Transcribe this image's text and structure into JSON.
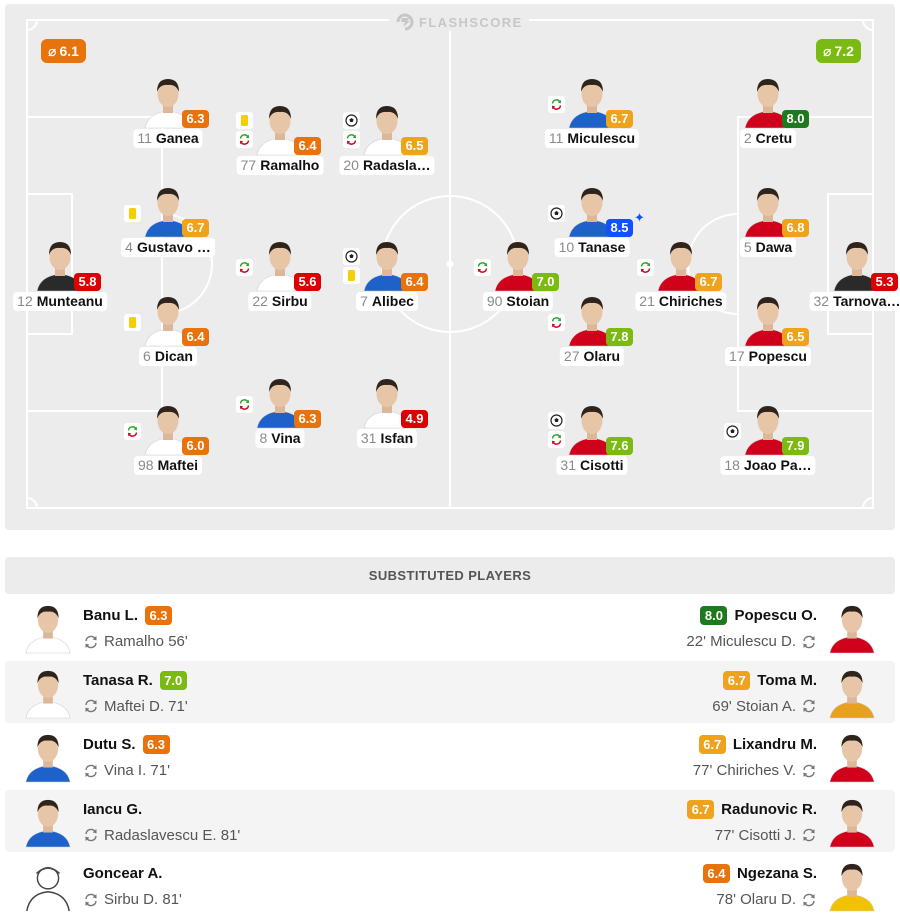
{
  "brand": "FLASHSCORE",
  "colors": {
    "rating_red": "#dc0000",
    "rating_orange": "#e8720c",
    "rating_yellow": "#efa21b",
    "rating_green": "#7aba12",
    "rating_darkgreen": "#1f7a1f",
    "rating_blue": "#1450ff"
  },
  "home": {
    "average": "6.1",
    "avg_color": "#e8720c",
    "players": [
      {
        "number": "11",
        "name": "Ganea",
        "rating": "6.3",
        "color": "#e8720c",
        "icons": [],
        "star": false,
        "shirt": "#ffffff"
      },
      {
        "number": "77",
        "name": "Ramalho",
        "rating": "6.4",
        "color": "#e8720c",
        "icons": [
          "yellow-card",
          "substitution"
        ],
        "star": false,
        "shirt": "#ffffff"
      },
      {
        "number": "20",
        "name": "Radasla…",
        "rating": "6.5",
        "color": "#efa21b",
        "icons": [
          "goal",
          "substitution"
        ],
        "star": false,
        "shirt": "#ffffff"
      },
      {
        "number": "4",
        "name": "Gustavo …",
        "rating": "6.7",
        "color": "#efa21b",
        "icons": [
          "yellow-card"
        ],
        "star": false,
        "shirt": "#1e62c9"
      },
      {
        "number": "12",
        "name": "Munteanu",
        "rating": "5.8",
        "color": "#dc0000",
        "icons": [],
        "star": false,
        "shirt": "#2a2a2a"
      },
      {
        "number": "22",
        "name": "Sirbu",
        "rating": "5.6",
        "color": "#dc0000",
        "icons": [
          "substitution"
        ],
        "star": false,
        "shirt": "#ffffff"
      },
      {
        "number": "7",
        "name": "Alibec",
        "rating": "6.4",
        "color": "#e8720c",
        "icons": [
          "goal",
          "yellow-card"
        ],
        "star": false,
        "shirt": "#1e62c9"
      },
      {
        "number": "6",
        "name": "Dican",
        "rating": "6.4",
        "color": "#e8720c",
        "icons": [
          "yellow-card"
        ],
        "star": false,
        "shirt": "#ffffff"
      },
      {
        "number": "8",
        "name": "Vina",
        "rating": "6.3",
        "color": "#e8720c",
        "icons": [
          "substitution"
        ],
        "star": false,
        "shirt": "#1e62c9"
      },
      {
        "number": "31",
        "name": "Isfan",
        "rating": "4.9",
        "color": "#dc0000",
        "icons": [],
        "star": false,
        "shirt": "#ffffff"
      },
      {
        "number": "98",
        "name": "Maftei",
        "rating": "6.0",
        "color": "#e8720c",
        "icons": [
          "substitution"
        ],
        "star": false,
        "shirt": "#ffffff"
      }
    ]
  },
  "away": {
    "average": "7.2",
    "avg_color": "#7aba12",
    "players": [
      {
        "number": "11",
        "name": "Miculescu",
        "rating": "6.7",
        "color": "#efa21b",
        "icons": [
          "substitution"
        ],
        "star": false,
        "shirt": "#1e62c9"
      },
      {
        "number": "2",
        "name": "Cretu",
        "rating": "8.0",
        "color": "#1f7a1f",
        "icons": [],
        "star": false,
        "shirt": "#d0021b"
      },
      {
        "number": "10",
        "name": "Tanase",
        "rating": "8.5",
        "color": "#1450ff",
        "icons": [
          "goal"
        ],
        "star": true,
        "shirt": "#1e62c9"
      },
      {
        "number": "5",
        "name": "Dawa",
        "rating": "6.8",
        "color": "#efa21b",
        "icons": [],
        "star": false,
        "shirt": "#d0021b"
      },
      {
        "number": "90",
        "name": "Stoian",
        "rating": "7.0",
        "color": "#7aba12",
        "icons": [
          "substitution"
        ],
        "star": false,
        "shirt": "#d0021b"
      },
      {
        "number": "21",
        "name": "Chiriches",
        "rating": "6.7",
        "color": "#efa21b",
        "icons": [
          "substitution"
        ],
        "star": false,
        "shirt": "#d0021b"
      },
      {
        "number": "32",
        "name": "Tarnova…",
        "rating": "5.3",
        "color": "#dc0000",
        "icons": [],
        "star": false,
        "shirt": "#2a2a2a"
      },
      {
        "number": "27",
        "name": "Olaru",
        "rating": "7.8",
        "color": "#7aba12",
        "icons": [
          "substitution"
        ],
        "star": false,
        "shirt": "#d0021b"
      },
      {
        "number": "17",
        "name": "Popescu",
        "rating": "6.5",
        "color": "#efa21b",
        "icons": [],
        "star": false,
        "shirt": "#d0021b"
      },
      {
        "number": "31",
        "name": "Cisotti",
        "rating": "7.6",
        "color": "#7aba12",
        "icons": [
          "goal",
          "substitution"
        ],
        "star": false,
        "shirt": "#d0021b"
      },
      {
        "number": "18",
        "name": "Joao Pa…",
        "rating": "7.9",
        "color": "#7aba12",
        "icons": [
          "goal"
        ],
        "star": false,
        "shirt": "#d0021b"
      }
    ]
  },
  "substitutes": {
    "title": "SUBSTITUTED PLAYERS",
    "rows": [
      {
        "home": {
          "name": "Banu L.",
          "rating": "6.3",
          "color": "#e8720c",
          "replaced": "Ramalho 56'",
          "shirt": "#ffffff",
          "placeholder": false
        },
        "away": {
          "name": "Popescu O.",
          "rating": "8.0",
          "color": "#1f7a1f",
          "replaced": "22' Miculescu D.",
          "shirt": "#d0021b",
          "placeholder": false
        }
      },
      {
        "home": {
          "name": "Tanasa R.",
          "rating": "7.0",
          "color": "#7aba12",
          "replaced": "Maftei D. 71'",
          "shirt": "#ffffff",
          "placeholder": false
        },
        "away": {
          "name": "Toma M.",
          "rating": "6.7",
          "color": "#efa21b",
          "replaced": "69' Stoian A.",
          "shirt": "#e8a020",
          "placeholder": false
        }
      },
      {
        "home": {
          "name": "Dutu S.",
          "rating": "6.3",
          "color": "#e8720c",
          "replaced": "Vina I. 71'",
          "shirt": "#1e62c9",
          "placeholder": false
        },
        "away": {
          "name": "Lixandru M.",
          "rating": "6.7",
          "color": "#efa21b",
          "replaced": "77' Chiriches V.",
          "shirt": "#d0021b",
          "placeholder": false
        }
      },
      {
        "home": {
          "name": "Iancu G.",
          "rating": "",
          "color": "",
          "replaced": "Radaslavescu E. 81'",
          "shirt": "#1e62c9",
          "placeholder": false
        },
        "away": {
          "name": "Radunovic R.",
          "rating": "6.7",
          "color": "#efa21b",
          "replaced": "77' Cisotti J.",
          "shirt": "#d0021b",
          "placeholder": false
        }
      },
      {
        "home": {
          "name": "Goncear A.",
          "rating": "",
          "color": "",
          "replaced": "Sirbu D. 81'",
          "shirt": "#ffffff",
          "placeholder": true
        },
        "away": {
          "name": "Ngezana S.",
          "rating": "6.4",
          "color": "#e8720c",
          "replaced": "78' Olaru D.",
          "shirt": "#f2c200",
          "placeholder": false
        }
      }
    ]
  }
}
